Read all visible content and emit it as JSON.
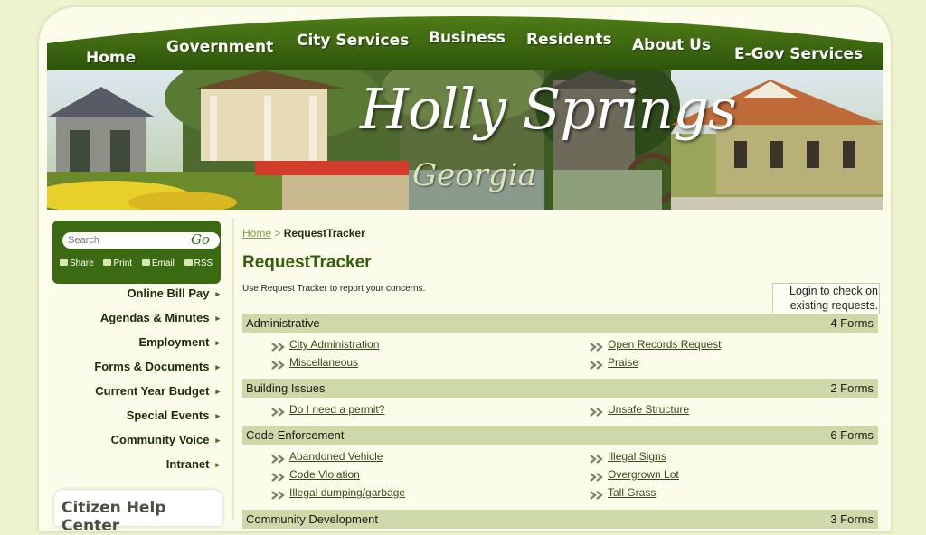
{
  "nav": [
    {
      "label": "Home"
    },
    {
      "label": "Government"
    },
    {
      "label": "City Services"
    },
    {
      "label": "Business"
    },
    {
      "label": "Residents"
    },
    {
      "label": "About Us"
    },
    {
      "label": "E-Gov Services"
    }
  ],
  "banner": {
    "title": "Holly Springs",
    "subtitle": "Georgia"
  },
  "search": {
    "placeholder": "Search",
    "go_label": "Go"
  },
  "tools": {
    "share": "Share",
    "print": "Print",
    "email": "Email",
    "rss": "RSS"
  },
  "sidebar": {
    "items": [
      {
        "label": "Online Bill Pay"
      },
      {
        "label": "Agendas & Minutes"
      },
      {
        "label": "Employment"
      },
      {
        "label": "Forms & Documents"
      },
      {
        "label": "Current Year Budget"
      },
      {
        "label": "Special Events"
      },
      {
        "label": "Community Voice"
      },
      {
        "label": "Intranet"
      }
    ],
    "arrow": "▸",
    "help_center": "Citizen Help Center"
  },
  "breadcrumb": {
    "home": "Home",
    "separator": ">",
    "current": "RequestTracker"
  },
  "main": {
    "title": "RequestTracker",
    "intro": "Use Request Tracker to report your concerns.",
    "login_link": "Login",
    "login_text_1": "to check on",
    "login_text_2": "existing requests."
  },
  "categories": [
    {
      "name": "Administrative",
      "count": "4 Forms",
      "forms": [
        "City Administration",
        "Open Records Request",
        "Miscellaneous",
        "Praise"
      ]
    },
    {
      "name": "Building Issues",
      "count": "2 Forms",
      "forms": [
        "Do I need a permit?",
        "Unsafe Structure"
      ]
    },
    {
      "name": "Code Enforcement",
      "count": "6 Forms",
      "forms": [
        "Abandoned Vehicle",
        "Illegal Signs",
        "Code Violation",
        "Overgrown Lot",
        "Illegal dumping/garbage",
        "Tall Grass"
      ]
    },
    {
      "name": "Community Development",
      "count": "3 Forms",
      "forms": []
    }
  ],
  "colors": {
    "nav_green": "#2f5a0b",
    "accent": "#355e0c",
    "category_bar": "#cfd8a8",
    "page_bg": "#eef2cf"
  }
}
